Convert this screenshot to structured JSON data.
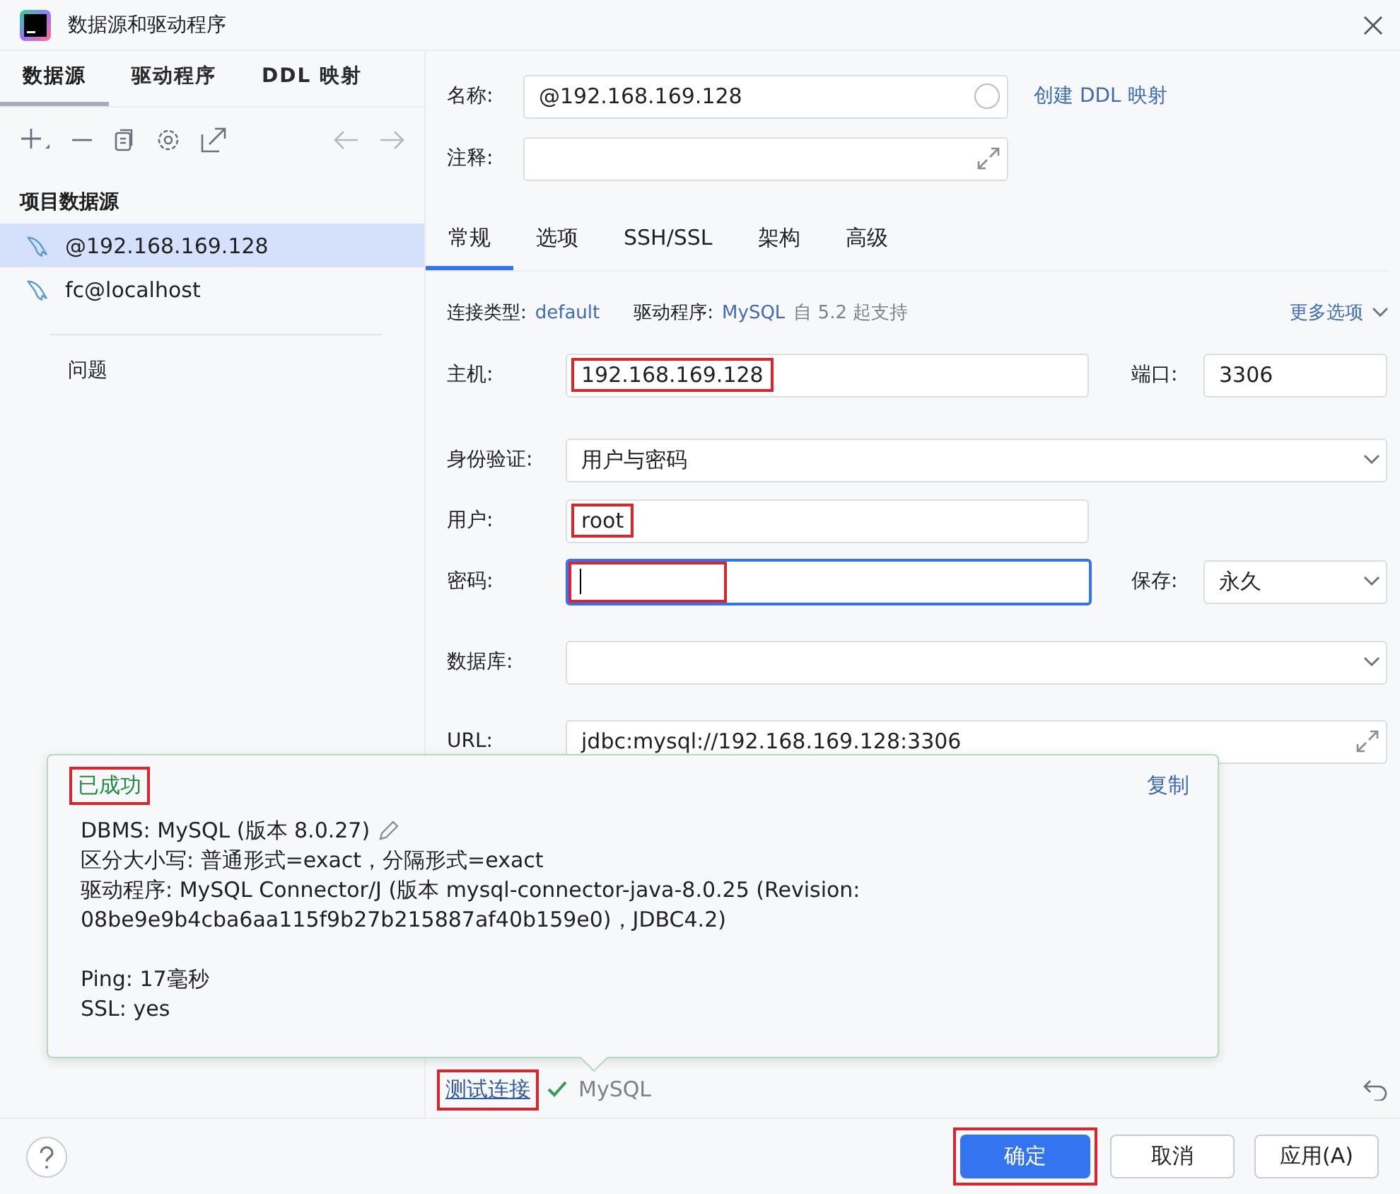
{
  "window": {
    "title": "数据源和驱动程序"
  },
  "left_tabs": [
    {
      "label": "数据源",
      "selected": true
    },
    {
      "label": "驱动程序",
      "selected": false
    },
    {
      "label": "DDL 映射",
      "selected": false
    }
  ],
  "sidebar": {
    "section": "项目数据源",
    "items": [
      {
        "label": "@192.168.169.128",
        "selected": true
      },
      {
        "label": "fc@localhost",
        "selected": false
      }
    ],
    "problems": "问题"
  },
  "name_field": {
    "label": "名称:",
    "value": "@192.168.169.128"
  },
  "create_ddl_link": "创建 DDL 映射",
  "comment_field": {
    "label": "注释:"
  },
  "tabs": [
    {
      "label": "常规",
      "selected": true
    },
    {
      "label": "选项",
      "selected": false
    },
    {
      "label": "SSH/SSL",
      "selected": false
    },
    {
      "label": "架构",
      "selected": false
    },
    {
      "label": "高级",
      "selected": false
    }
  ],
  "info": {
    "connection_type_label": "连接类型:",
    "connection_type": "default",
    "driver_label": "驱动程序:",
    "driver": "MySQL",
    "driver_note": "自 5.2 起支持",
    "more_options": "更多选项"
  },
  "host": {
    "label": "主机:",
    "value": "192.168.169.128",
    "marked": true
  },
  "port": {
    "label": "端口:",
    "value": "3306"
  },
  "auth": {
    "label": "身份验证:",
    "value": "用户与密码"
  },
  "user": {
    "label": "用户:",
    "value": "root",
    "marked": true
  },
  "password": {
    "label": "密码:",
    "focused": true,
    "marked": true
  },
  "save": {
    "label": "保存:",
    "value": "永久"
  },
  "database": {
    "label": "数据库:"
  },
  "url": {
    "label": "URL:",
    "value": "jdbc:mysql://192.168.169.128:3306"
  },
  "popup": {
    "status": "已成功",
    "marked": true,
    "copy": "复制",
    "lines": [
      "DBMS: MySQL (版本 8.0.27)",
      "区分大小写: 普通形式=exact，分隔形式=exact",
      "驱动程序: MySQL Connector/J (版本 mysql-connector-java-8.0.25 (Revision: 08be9e9b4cba6aa115f9b27b215887af40b159e0)，JDBC4.2)"
    ],
    "ping": "Ping: 17毫秒",
    "ssl": "SSL: yes"
  },
  "test": {
    "link": "测试连接",
    "marked": true,
    "ok": true,
    "driver": "MySQL"
  },
  "buttons": [
    {
      "label": "确定",
      "primary": true,
      "marked": true
    },
    {
      "label": "取消",
      "primary": false,
      "marked": false
    },
    {
      "label": "应用(A)",
      "primary": false,
      "marked": false
    }
  ]
}
